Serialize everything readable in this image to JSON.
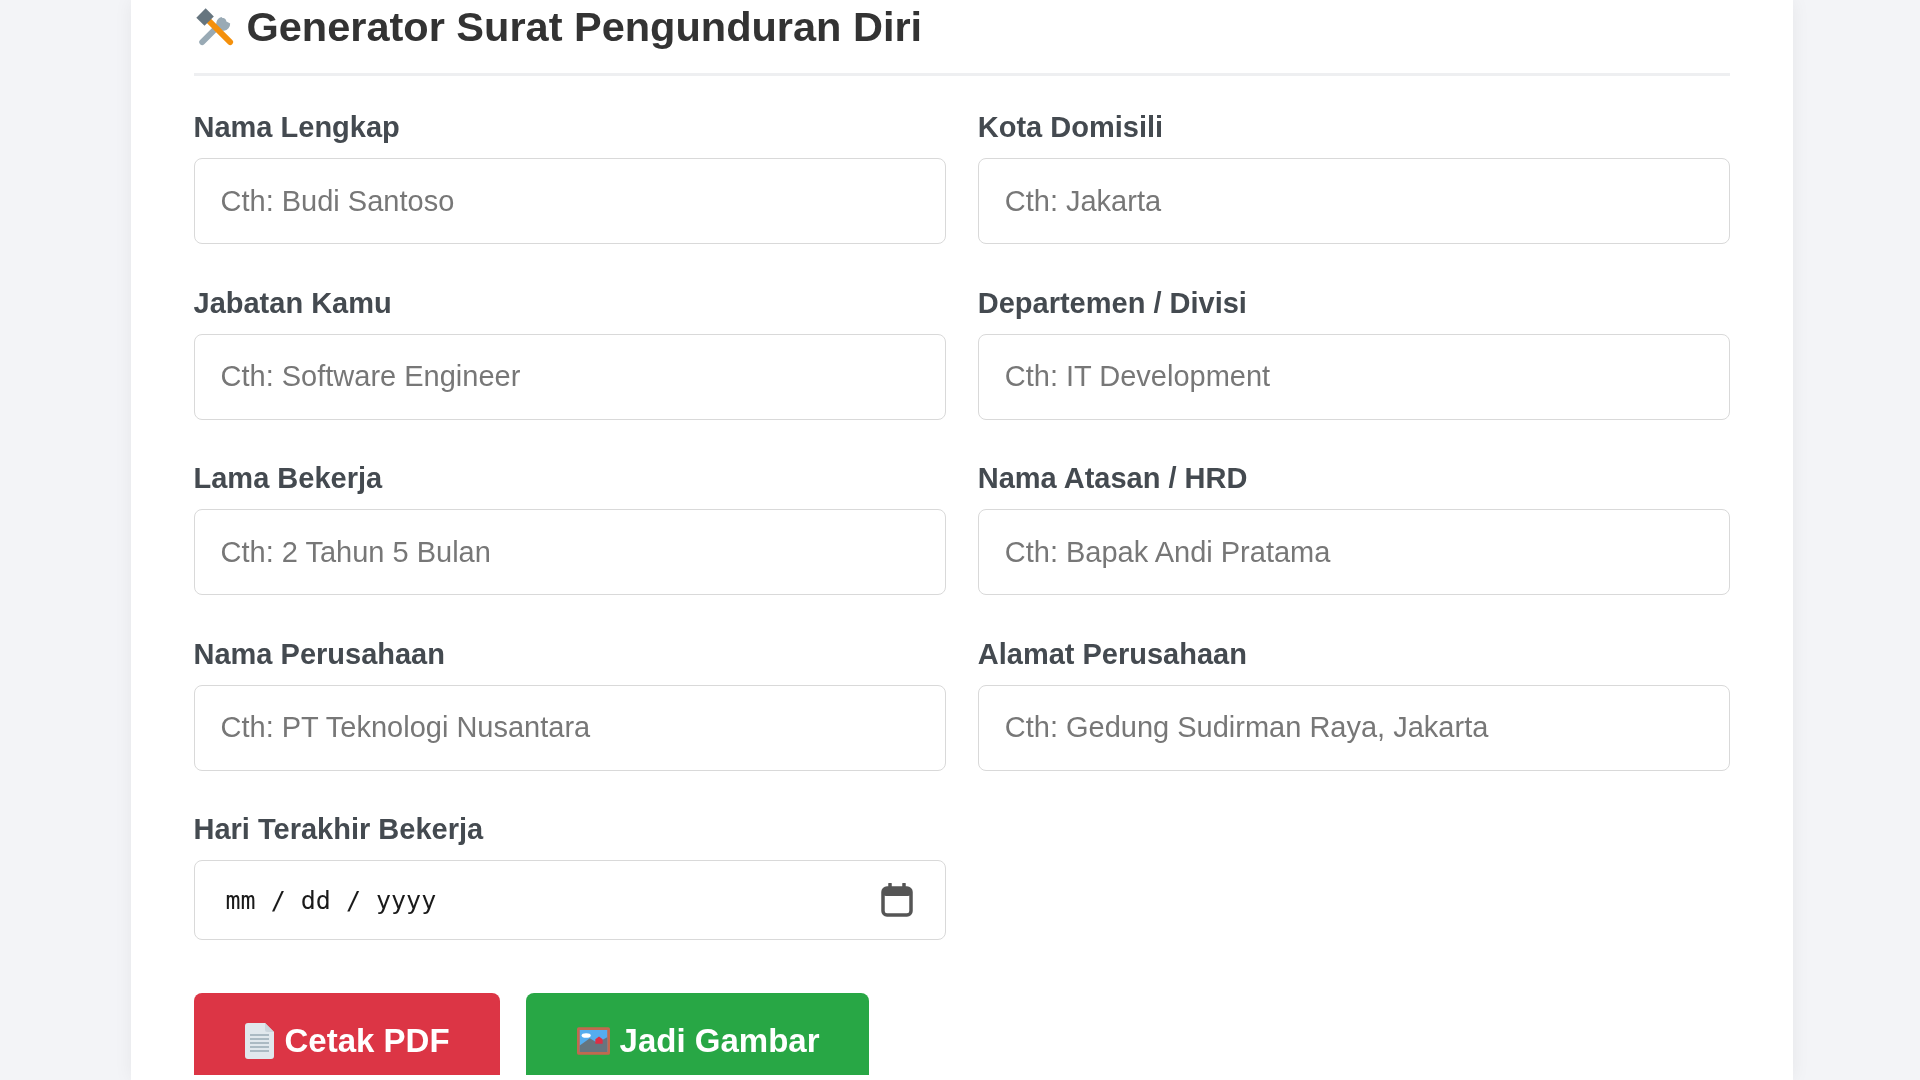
{
  "title": "Generator Surat Pengunduran Diri",
  "fields": [
    {
      "label": "Nama Lengkap",
      "placeholder": "Cth: Budi Santoso",
      "kind": "text"
    },
    {
      "label": "Kota Domisili",
      "placeholder": "Cth: Jakarta",
      "kind": "text"
    },
    {
      "label": "Jabatan Kamu",
      "placeholder": "Cth: Software Engineer",
      "kind": "text"
    },
    {
      "label": "Departemen / Divisi",
      "placeholder": "Cth: IT Development",
      "kind": "text"
    },
    {
      "label": "Lama Bekerja",
      "placeholder": "Cth: 2 Tahun 5 Bulan",
      "kind": "text"
    },
    {
      "label": "Nama Atasan / HRD",
      "placeholder": "Cth: Bapak Andi Pratama",
      "kind": "text"
    },
    {
      "label": "Nama Perusahaan",
      "placeholder": "Cth: PT Teknologi Nusantara",
      "kind": "text"
    },
    {
      "label": "Alamat Perusahaan",
      "placeholder": "Cth: Gedung Sudirman Raya, Jakarta",
      "kind": "text"
    },
    {
      "label": "Hari Terakhir Bekerja",
      "placeholder": "mm / dd / yyyy",
      "kind": "date"
    }
  ],
  "buttons": [
    {
      "label": "Cetak PDF",
      "kind": "pdf"
    },
    {
      "label": "Jadi Gambar",
      "kind": "image"
    }
  ]
}
